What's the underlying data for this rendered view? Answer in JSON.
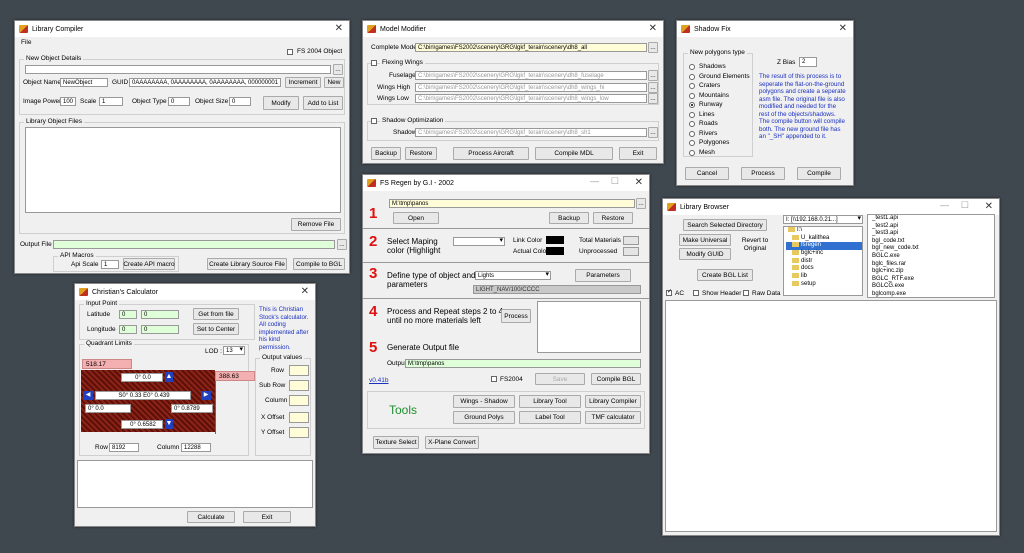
{
  "library_compiler": {
    "title": "Library Compiler",
    "menu_file": "File",
    "fs2004_checkbox": "FS 2004 Object",
    "new_object_details": "New Object Details",
    "object_name_label": "Object Name",
    "object_name_value": "NewObject",
    "guid_label": "GUID",
    "guid_value": "0AAAAAAAA, 0AAAAAAAA, 0AAAAAAAA, 000000001",
    "increment_button": "Increment",
    "new_button": "New",
    "image_power_label": "Image Power",
    "image_power_value": "100",
    "scale_label": "Scale",
    "scale_value": "1",
    "object_type_label": "Object Type",
    "object_type_value": "0",
    "object_size_label": "Object Size",
    "object_size_value": "0",
    "modify_button": "Modify",
    "add_to_list_button": "Add to List",
    "library_object_files": "Library Object Files",
    "remove_file_button": "Remove File",
    "output_file_label": "Output File",
    "api_macros": "API Macros",
    "api_scale_label": "Api Scale",
    "api_scale_value": "1",
    "create_api_macro_button": "Create API macro",
    "create_library_source_button": "Create Library Source File",
    "compile_to_bgl_button": "Compile to BGL"
  },
  "model_modifier": {
    "title": "Model Modifier",
    "complete_model_label": "Complete Model",
    "complete_model_value": "C:\\bin\\games\\FS2002\\scenery\\GRG\\lgkf_terain\\scenery\\dh8_all",
    "flexing_wings": "Flexing Wings",
    "fuselage_label": "Fuselage",
    "fuselage_value": "C:\\bin\\games\\FS2002\\scenery\\GRG\\lgkf_terain\\scenery\\dh8_fuselage",
    "wings_high_label": "Wings High",
    "wings_high_value": "C:\\bin\\games\\FS2002\\scenery\\GRG\\lgkf_terain\\scenery\\dh8_wings_hi",
    "wings_low_label": "Wings Low",
    "wings_low_value": "C:\\bin\\games\\FS2002\\scenery\\GRG\\lgkf_terain\\scenery\\dh8_wings_low",
    "shadow_optimization": "Shadow Optimization",
    "shadow_label": "Shadow",
    "shadow_value": "C:\\bin\\games\\FS2002\\scenery\\GRG\\lgkf_terain\\scenery\\dh8_sh1",
    "backup_button": "Backup",
    "restore_button": "Restore",
    "process_aircraft_button": "Process Aircraft",
    "compile_mdl_button": "Compile MDL",
    "exit_button": "Exit"
  },
  "shadow_fix": {
    "title": "Shadow Fix",
    "group_title": "New polygons type",
    "options": [
      "Shadows",
      "Ground Elements",
      "Craters",
      "Mountains",
      "Runway",
      "Lines",
      "Roads",
      "Rivers",
      "Polygones",
      "Mesh"
    ],
    "selected": "Runway",
    "z_bias_label": "Z Bias",
    "z_bias_value": "2",
    "description": "The result of this process is to seperate the flat-on-the-ground polygons and create a seperate asm file. The original file is also modified and needed for the rest of the objects/shadows. The compile button will compile both. The new ground file has an \"_SH\" appended to it.",
    "cancel_button": "Cancel",
    "process_button": "Process",
    "compile_button": "Compile"
  },
  "fsregen": {
    "title": "FS Regen by G.I - 2002",
    "step1_num": "1",
    "path_value": "M:\\tmp\\panos",
    "open_button": "Open",
    "backup_button": "Backup",
    "restore_button": "Restore",
    "step2_num": "2",
    "select_mapping_label": "Select Maping",
    "color_highlight_label": "color (Highlight",
    "link_color_label": "Link Color",
    "actual_color_label": "Actual Color",
    "total_materials_label": "Total Materials",
    "unprocessed_label": "Unprocessed",
    "step3_num": "3",
    "define_type_label": "Define type of object and",
    "parameters_label": "parameters",
    "type_select_value": "Lights",
    "parameters_button": "Parameters",
    "light_nav_value": "LIGHT_NAV/100/CCCC",
    "step4_num": "4",
    "process_repeat_label": "Process and Repeat steps 2 to 4",
    "until_label": "until no more materials left",
    "process_button": "Process",
    "step5_num": "5",
    "generate_output_label": "Generate Output file",
    "output_label": "Output",
    "output_value": "M:\\tmp\\panos",
    "version_link": "v0.41b",
    "fs2004_checkbox": "FS2004",
    "save_button": "Save",
    "compile_bgl_button": "Compile BGL",
    "tools_label": "Tools",
    "wings_shadow_button": "Wings - Shadow",
    "library_tool_button": "Library Tool",
    "library_compiler_button": "Library Compiler",
    "ground_polys_button": "Ground Polys",
    "label_tool_button": "Label Tool",
    "tmf_calculator_button": "TMF calculator",
    "texture_select_button": "Texture Select",
    "xplane_convert_button": "X-Plane Convert"
  },
  "calculator": {
    "title": "Christian's Calculator",
    "input_point": "Input Point",
    "latitude_label": "Latitude",
    "lat_a": "0",
    "lat_b": "0",
    "longitude_label": "Longitude",
    "lon_a": "0",
    "lon_b": "0",
    "get_from_file_button": "Get from file",
    "set_to_center_button": "Set to Center",
    "info_text": "This is Christian Stock's calculator. All coding implemented after his kind permission.",
    "quadrant_limits": "Quadrant Limits",
    "lod_label": "LOD :",
    "lod_value": "13",
    "top_left_value": "518.17",
    "right_value": "388.63",
    "north_value": "0° 0.0",
    "center_value": "S0° 0.33  E0° 0.439",
    "west_value": "0° 0.0",
    "east_value": "0° 0.8789",
    "south_value": "0° 0.6582",
    "row_label": "Row",
    "row_value": "8192",
    "column_label": "Column",
    "column_value": "12288",
    "output_values": "Output values",
    "out_row_label": "Row",
    "sub_row_label": "Sub Row",
    "out_column_label": "Column",
    "x_offset_label": "X Offset",
    "y_offset_label": "Y Offset",
    "calculate_button": "Calculate",
    "exit_button": "Exit"
  },
  "library_browser": {
    "title": "Library Browser",
    "search_selected_button": "Search Selected Directory",
    "drive_value": "I: [\\\\192.168.0.21...]",
    "make_universal_button": "Make Universal",
    "revert_button_line1": "Revert to",
    "revert_button_line2": "Original",
    "modify_guid_button": "Modify GUID",
    "create_bgl_list_button": "Create BGL List",
    "ac_checkbox": "AC",
    "show_header_checkbox": "Show Header",
    "raw_data_checkbox": "Raw Data",
    "folders": [
      "I:\\",
      "U_kalithea",
      "fsregen",
      "bglc+inc",
      "distr",
      "docs",
      "lib",
      "setup"
    ],
    "selected_folder": "fsregen",
    "files": [
      "_test1.api",
      "_test2.api",
      "_test3.api",
      "bgl_code.txt",
      "bgl_new_code.txt",
      "BGLC.exe",
      "bglc_files.rar",
      "bglc+inc.zip",
      "BGLC_RTF.exe",
      "BGLCG.exe",
      "bglcomp.exe",
      "bglcomp.xsd"
    ]
  }
}
